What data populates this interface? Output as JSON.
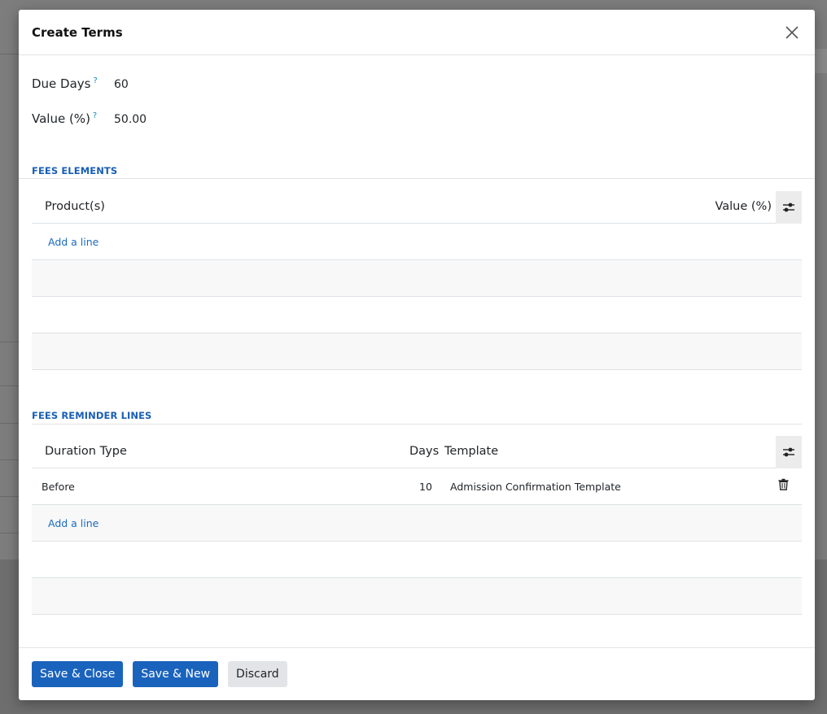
{
  "dialog": {
    "title": "Create Terms"
  },
  "fields": {
    "due_days": {
      "label": "Due Days",
      "help": "?",
      "value": "60"
    },
    "value_pct": {
      "label": "Value (%)",
      "help": "?",
      "value": "50.00"
    }
  },
  "fees_elements": {
    "title": "FEES ELEMENTS",
    "columns": [
      "Product(s)",
      "Value (%)"
    ],
    "add_line": "Add a line"
  },
  "fees_reminder_lines": {
    "title": "FEES REMINDER LINES",
    "columns": [
      "Duration Type",
      "Days",
      "Template"
    ],
    "rows": [
      {
        "duration_type": "Before",
        "days": "10",
        "template": "Admission Confirmation Template"
      }
    ],
    "add_line": "Add a line"
  },
  "footer": {
    "save_close": "Save & Close",
    "save_new": "Save & New",
    "discard": "Discard"
  },
  "colors": {
    "accent": "#1a63bd",
    "link": "#1a6bbf",
    "help": "#0a8fb0"
  },
  "icons": {
    "close": "close-icon",
    "settings": "sliders-icon",
    "delete": "trash-icon"
  }
}
